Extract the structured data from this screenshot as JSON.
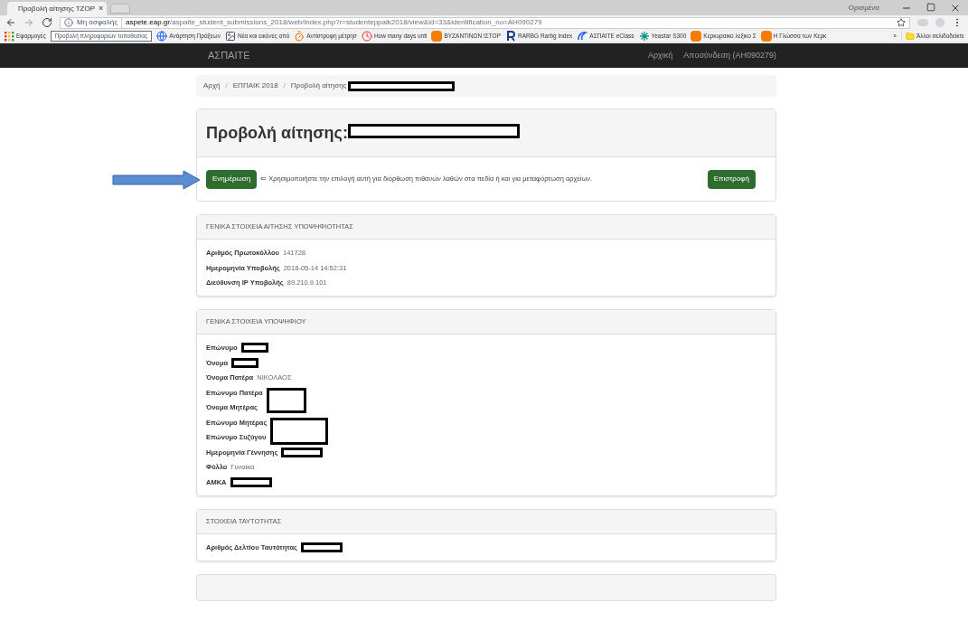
{
  "browser": {
    "tab_title": "Προβολή αίτησης ΤΖΟΡ",
    "tab_close": "×",
    "security_label": "Μη ασφαλής",
    "url_host": "aspete.eap.gr",
    "url_path": "/aspaite_student_submissions_2018/web/index.php?r=studenteppaik2018/view&id=33&identification_no=AH090279",
    "profile": "Ορισμένα",
    "bookmarks": [
      {
        "label": "Εφαρμογές",
        "kind": "apps"
      },
      {
        "label": "Προβολή πληροφοριών τοποθεσίας",
        "kind": "tooltip"
      },
      {
        "label": "Ανάρτηση Πράξεων",
        "kind": "globe"
      },
      {
        "label": "Νέα και εικόνες από",
        "kind": "page"
      },
      {
        "label": "Αντίστροφη μέτρησ",
        "kind": "timer"
      },
      {
        "label": "How many days unti",
        "kind": "clock"
      },
      {
        "label": "ΒΥΖΑΝΤΙΝΩΝ ΙΣΤΟΡ",
        "kind": "blog"
      },
      {
        "label": "RARBG Rarbg Index",
        "kind": "letter"
      },
      {
        "label": "ΑΣΠΑΙΤΕ eClass",
        "kind": "eclass"
      },
      {
        "label": "Yeastar S300",
        "kind": "star"
      },
      {
        "label": "Κερκυραικο λεξικο Σ",
        "kind": "blog"
      },
      {
        "label": "Η Γλώσσα των Κερκ",
        "kind": "blog"
      }
    ],
    "more": "»",
    "other_bookmarks": "Άλλοι σελιδοδείκτε"
  },
  "navbar": {
    "brand": "ΑΣΠΑΙΤΕ",
    "links": [
      "Αρχική",
      "Αποσύνδεση (AH090279)"
    ]
  },
  "breadcrumb": {
    "items": [
      "Αρχή",
      "ΕΠΠΑΙΚ 2018",
      "Προβολή αίτησης"
    ],
    "separator": "/",
    "redacted": true
  },
  "heading": {
    "title": "Προβολή αίτησης:",
    "redacted": true
  },
  "actions": {
    "update_button": "Ενημέρωση",
    "hint": "⇐ Χρησιμοποιήστε την επιλογή αυτή για διόρθωση πιθανών λαθών στα πεδία ή και για μεταφόρτωση αρχείων.",
    "back_button": "Επιστροφή",
    "annotation_arrow": true
  },
  "sections": [
    {
      "title": "ΓΕΝΙΚΑ ΣΤΟΙΧΕΙΑ ΑΙΤΗΣΗΣ ΥΠΟΨΗΦΙΟΤΗΤΑΣ",
      "fields": [
        {
          "label": "Αριθμός Πρωτοκόλλου",
          "value": "141728"
        },
        {
          "label": "Ημερομηνία Υποβολής",
          "value": "2018-05-14 14:52:31"
        },
        {
          "label": "Διεύθυνση IP Υποβολής",
          "value": "89.210.9.101"
        }
      ]
    },
    {
      "title": "ΓΕΝΙΚΑ ΣΤΟΙΧΕΙΑ ΥΠΟΨΗΦΙΟΥ",
      "fields": [
        {
          "label": "Επώνυμο",
          "redacted": true
        },
        {
          "label": "Όνομα",
          "redacted": true
        },
        {
          "label": "Όνομα Πατέρα",
          "value": "ΝΙΚΟΛΑΟΣ"
        },
        {
          "label": "Επώνυμο Πατέρα",
          "redacted": true
        },
        {
          "label": "Όνομα Μητέρας"
        },
        {
          "label": "Επώνυμο Μητέρας",
          "redacted": true
        },
        {
          "label": "Επώνυμο Συζύγου"
        },
        {
          "label": "Ημερομηνία Γέννησης",
          "redacted": true
        },
        {
          "label": "Φύλλο",
          "value": "Γυναίκα"
        },
        {
          "label": "ΑΜΚΑ",
          "redacted": true
        }
      ]
    },
    {
      "title": "ΣΤΟΙΧΕΙΑ ΤΑΥΤΟΤΗΤΑΣ",
      "fields": [
        {
          "label": "Αριθμός Δελτίου Ταυτότητας",
          "redacted": true
        }
      ]
    }
  ]
}
